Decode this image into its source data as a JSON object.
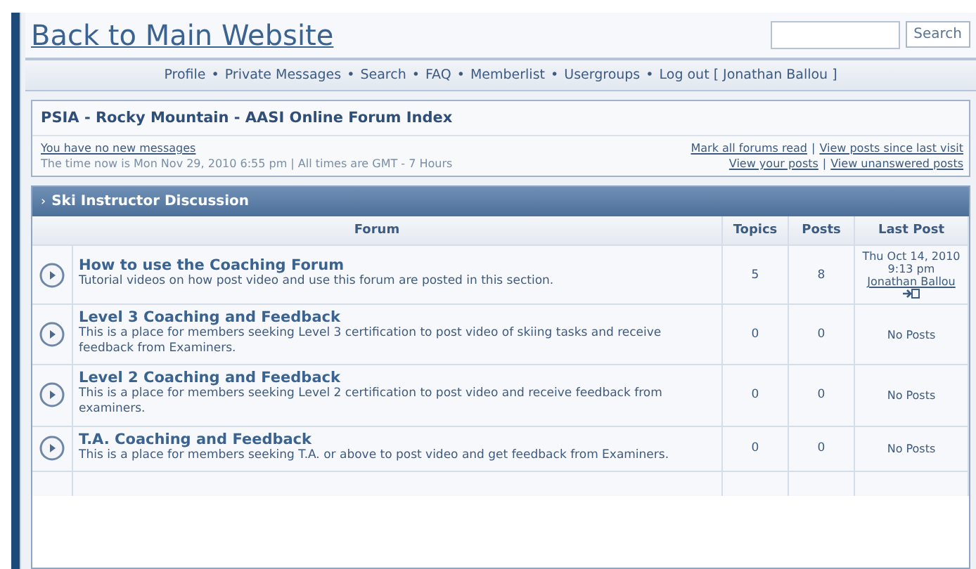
{
  "header": {
    "title": "Back to Main Website",
    "search_button": "Search"
  },
  "nav": [
    "Profile",
    "Private Messages",
    "Search",
    "FAQ",
    "Memberlist",
    "Usergroups",
    "Log out [ Jonathan Ballou ]"
  ],
  "nav_separator": "•",
  "index": {
    "title": "PSIA - Rocky Mountain - AASI Online Forum Index",
    "messages": "You have no new messages",
    "time": "The time now is Mon Nov 29, 2010 6:55 pm | All times are GMT - 7 Hours",
    "links_1": [
      "Mark all forums read",
      "View posts since last visit"
    ],
    "links_2": [
      "View your posts",
      "View unanswered posts"
    ],
    "link_separator": "|"
  },
  "category": {
    "marker": "›",
    "title": "Ski Instructor Discussion"
  },
  "table": {
    "columns": [
      "Forum",
      "Topics",
      "Posts",
      "Last Post"
    ],
    "rows": [
      {
        "title": "How to use the Coaching Forum",
        "description": "Tutorial videos on how post video and use this forum are posted in this section.",
        "topics": "5",
        "posts": "8",
        "last_post": {
          "date": "Thu Oct 14, 2010",
          "time": "9:13 pm",
          "author": "Jonathan Ballou"
        }
      },
      {
        "title": "Level 3 Coaching and Feedback",
        "description": "This is a place for members seeking Level 3 certification to post video of skiing tasks and receive feedback from Examiners.",
        "topics": "0",
        "posts": "0",
        "last_post": {
          "none": "No Posts"
        }
      },
      {
        "title": "Level 2 Coaching and Feedback",
        "description": "This is a place for members seeking Level 2 certification to post video and receive feedback from examiners.",
        "topics": "0",
        "posts": "0",
        "last_post": {
          "none": "No Posts"
        }
      },
      {
        "title": "T.A. Coaching and Feedback",
        "description": "This is a place for members seeking T.A. or above to post video and get feedback from Examiners.",
        "topics": "0",
        "posts": "0",
        "last_post": {
          "none": "No Posts"
        }
      }
    ]
  }
}
